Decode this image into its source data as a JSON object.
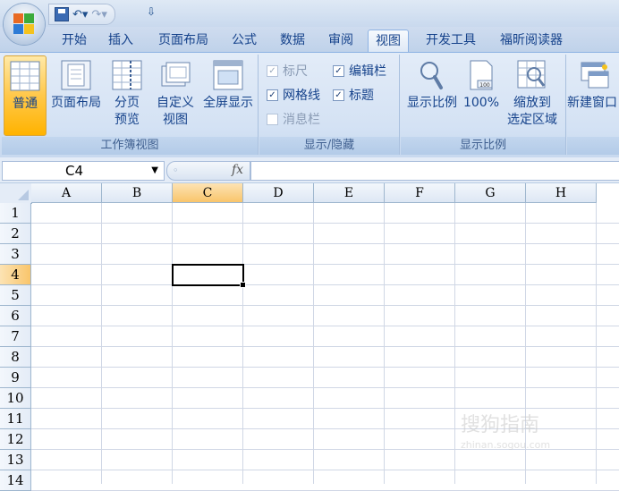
{
  "quick_access": {
    "undo_icon": "undo-icon",
    "redo_icon": "redo-icon",
    "extra": "⇧"
  },
  "tabs": [
    {
      "label": "开始",
      "active": false
    },
    {
      "label": "插入",
      "active": false
    },
    {
      "label": "页面布局",
      "active": false
    },
    {
      "label": "公式",
      "active": false
    },
    {
      "label": "数据",
      "active": false
    },
    {
      "label": "审阅",
      "active": false
    },
    {
      "label": "视图",
      "active": true
    },
    {
      "label": "开发工具",
      "active": false
    },
    {
      "label": "福昕阅读器",
      "active": false
    }
  ],
  "ribbon": {
    "workbook_views": {
      "label": "工作簿视图",
      "normal": "普通",
      "page_layout": "页面布局",
      "page_break_line1": "分页",
      "page_break_line2": "预览",
      "custom_line1": "自定义",
      "custom_line2": "视图",
      "fullscreen": "全屏显示"
    },
    "show_hide": {
      "label": "显示/隐藏",
      "ruler": {
        "label": "标尺",
        "checked": true,
        "enabled": false
      },
      "formula_bar": {
        "label": "编辑栏",
        "checked": true,
        "enabled": true
      },
      "gridlines": {
        "label": "网格线",
        "checked": true,
        "enabled": true
      },
      "headings": {
        "label": "标题",
        "checked": true,
        "enabled": true
      },
      "message_bar": {
        "label": "消息栏",
        "checked": false,
        "enabled": false
      }
    },
    "zoom": {
      "label": "显示比例",
      "zoom_btn": "显示比例",
      "hundred": "100%",
      "zoom_sel_line1": "缩放到",
      "zoom_sel_line2": "选定区域"
    },
    "window": {
      "new_window": "新建窗口"
    }
  },
  "formula_bar": {
    "name_box": "C4",
    "fx": "fx",
    "value": ""
  },
  "sheet": {
    "columns": [
      "A",
      "B",
      "C",
      "D",
      "E",
      "F",
      "G",
      "H"
    ],
    "rows": [
      "1",
      "2",
      "3",
      "4",
      "5",
      "6",
      "7",
      "8",
      "9",
      "10",
      "11",
      "12",
      "13",
      "14"
    ],
    "active_cell": "C4"
  },
  "watermark": {
    "text": "搜狗指南",
    "sub": "zhinan.sogou.com"
  },
  "colors": {
    "accent": "#ffc84a",
    "ribbon": "#d4e2f4",
    "grid": "#d0d7e5"
  }
}
